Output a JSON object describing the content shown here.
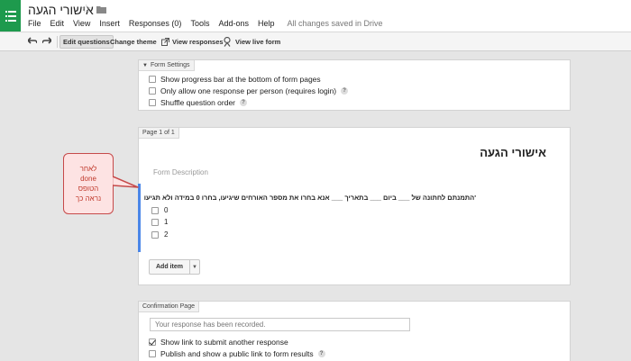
{
  "doc": {
    "title": "אישורי הגעה"
  },
  "menu": {
    "items": [
      "File",
      "Edit",
      "View",
      "Insert",
      "Responses (0)",
      "Tools",
      "Add-ons",
      "Help"
    ],
    "saved_status": "All changes saved in Drive"
  },
  "toolbar": {
    "edit_questions": "Edit questions",
    "change_theme": "Change theme",
    "view_responses": "View responses",
    "view_live_form": "View live form"
  },
  "settings": {
    "label": "Form Settings",
    "options": [
      {
        "text": "Show progress bar at the bottom of form pages",
        "checked": false,
        "help": false
      },
      {
        "text": "Only allow one response per person (requires login)",
        "checked": false,
        "help": true
      },
      {
        "text": "Shuffle question order",
        "checked": false,
        "help": true
      }
    ]
  },
  "page": {
    "label": "Page 1 of 1",
    "form_title": "אישורי הגעה",
    "form_description": "Form Description",
    "question": "'התמנתם לחתונה של ___ ביום ___ בתאריך ___ אנא בחרו את מספר האורחים שיגיעו, בחרו 0 במידה ולא תגיעו",
    "choices": [
      "0",
      "1",
      "2"
    ],
    "add_item": "Add item"
  },
  "confirmation": {
    "label": "Confirmation Page",
    "message_value": "Your response has been recorded.",
    "options": [
      {
        "text": "Show link to submit another response",
        "checked": true,
        "help": false
      },
      {
        "text": "Publish and show a public link to form results",
        "checked": false,
        "help": true
      }
    ]
  },
  "annotation": {
    "lines": [
      "לאחר",
      "done",
      "הטופס",
      "נראה כך"
    ]
  },
  "colors": {
    "app_green": "#1e9a4d",
    "question_accent": "#4a86e8",
    "callout_border": "#c64a4a",
    "callout_fill": "#fde3e3"
  }
}
